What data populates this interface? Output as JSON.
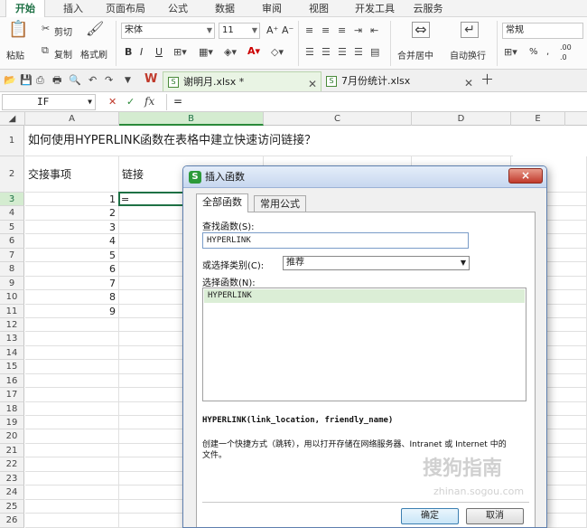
{
  "menu": [
    "开始",
    "插入",
    "页面布局",
    "公式",
    "数据",
    "审阅",
    "视图",
    "开发工具",
    "云服务"
  ],
  "ribbon": {
    "paste": "粘贴",
    "cut": "剪切",
    "copy": "复制",
    "format_painter": "格式刷",
    "font_name": "宋体",
    "font_size": "11",
    "grow_font": "A⁺",
    "shrink_font": "A⁻",
    "bold": "B",
    "italic": "I",
    "underline": "U",
    "merge_center": "合并居中",
    "wrap_text": "自动换行",
    "number_format": "常规",
    "percent": "%",
    "comma": ",",
    "inc_decimal": ".00",
    "dec_decimal": ".0"
  },
  "doc_tabs": [
    {
      "name": "谢明月.xlsx *",
      "active": true
    },
    {
      "name": "7月份统计.xlsx",
      "active": false
    }
  ],
  "formula_bar": {
    "name_box": "IF",
    "fx": "fx",
    "content": "="
  },
  "columns": [
    "A",
    "B",
    "C",
    "D",
    "E"
  ],
  "rows": [
    "1",
    "2",
    "3",
    "4",
    "5",
    "6",
    "7",
    "8",
    "9",
    "10",
    "11",
    "12",
    "13",
    "14",
    "15",
    "16",
    "17",
    "18",
    "19",
    "20",
    "21",
    "22",
    "23",
    "24",
    "25",
    "26"
  ],
  "sheet": {
    "title": "如何使用HYPERLINK函数在表格中建立快速访问链接？",
    "header_a": "交接事项",
    "header_b": "链接",
    "values": [
      "1",
      "2",
      "3",
      "4",
      "5",
      "6",
      "7",
      "8",
      "9"
    ],
    "active_value": "="
  },
  "dialog": {
    "title": "插入函数",
    "close": "×",
    "tabs": [
      "全部函数",
      "常用公式"
    ],
    "search_label": "查找函数(S):",
    "search_value": "HYPERLINK",
    "category_label": "或选择类别(C):",
    "category_value": "推荐",
    "list_label": "选择函数(N):",
    "list_items": [
      "HYPERLINK"
    ],
    "signature": "HYPERLINK(link_location, friendly_name)",
    "description": "创建一个快捷方式（跳转），用以打开存储在网络服务器、Intranet 或 Internet 中的文件。",
    "ok": "确定",
    "cancel": "取消"
  },
  "watermark": "搜狗指南",
  "watermark_url": "zhinan.sogou.com",
  "colors": {
    "accent": "#1e7145",
    "selected_header": "#d4ecd0"
  }
}
